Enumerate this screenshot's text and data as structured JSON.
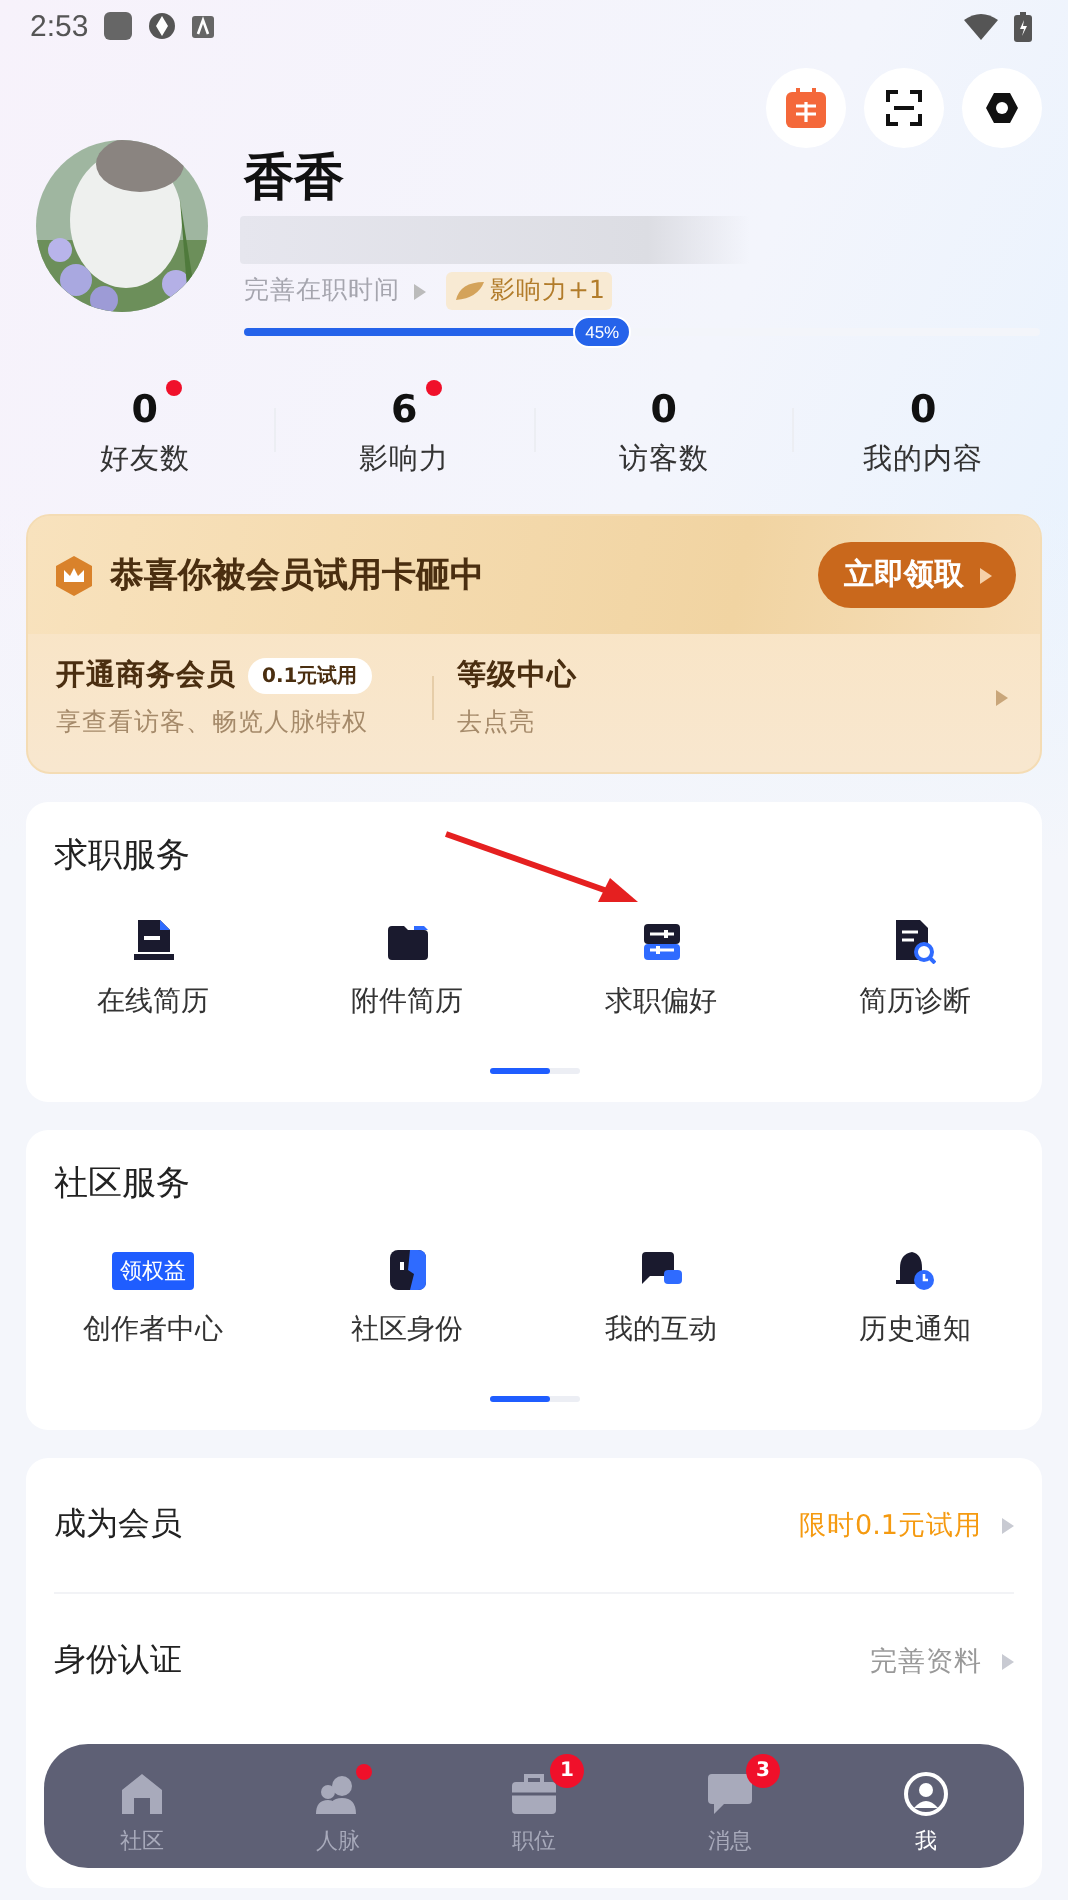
{
  "status_bar": {
    "time": "2:53"
  },
  "profile": {
    "name": "香香",
    "tenure_link": "完善在职时间",
    "influence_badge": "影响力+1",
    "progress": {
      "level": 0.45,
      "label": "45%"
    }
  },
  "stats": [
    {
      "value": "0",
      "label": "好友数",
      "dot": true
    },
    {
      "value": "6",
      "label": "影响力",
      "dot": true
    },
    {
      "value": "0",
      "label": "访客数",
      "dot": false
    },
    {
      "value": "0",
      "label": "我的内容",
      "dot": false
    }
  ],
  "vip_card": {
    "title": "恭喜你被会员试用卡砸中",
    "claim_button": "立即领取",
    "business": {
      "title": "开通商务会员",
      "tag": "0.1元试用",
      "subtitle": "享查看访客、畅览人脉特权"
    },
    "level_center": {
      "title": "等级中心",
      "subtitle": "去点亮"
    }
  },
  "sections": [
    {
      "title": "求职服务",
      "items": [
        {
          "kind": "resume",
          "label": "在线简历"
        },
        {
          "kind": "folder",
          "label": "附件简历"
        },
        {
          "kind": "preferences",
          "label": "求职偏好"
        },
        {
          "kind": "diagnose",
          "label": "简历诊断"
        }
      ]
    },
    {
      "title": "社区服务",
      "items": [
        {
          "kind": "tag",
          "tag": "领权益",
          "label": "创作者中心"
        },
        {
          "kind": "identity",
          "label": "社区身份"
        },
        {
          "kind": "chat",
          "label": "我的互动"
        },
        {
          "kind": "bell",
          "label": "历史通知"
        }
      ]
    }
  ],
  "list": [
    {
      "label": "成为会员",
      "value": "限时0.1元试用",
      "highlight": true
    },
    {
      "label": "身份认证",
      "value": "完善资料",
      "highlight": false
    }
  ],
  "tab_bar": [
    {
      "kind": "home",
      "label": "社区",
      "selected": false,
      "dot": false
    },
    {
      "kind": "people",
      "label": "人脉",
      "selected": false,
      "dot": true
    },
    {
      "kind": "briefcase",
      "label": "职位",
      "selected": false,
      "dot": false,
      "badge": "1"
    },
    {
      "kind": "message",
      "label": "消息",
      "selected": false,
      "dot": false,
      "badge": "3"
    },
    {
      "kind": "me",
      "label": "我",
      "selected": true,
      "dot": false
    }
  ]
}
